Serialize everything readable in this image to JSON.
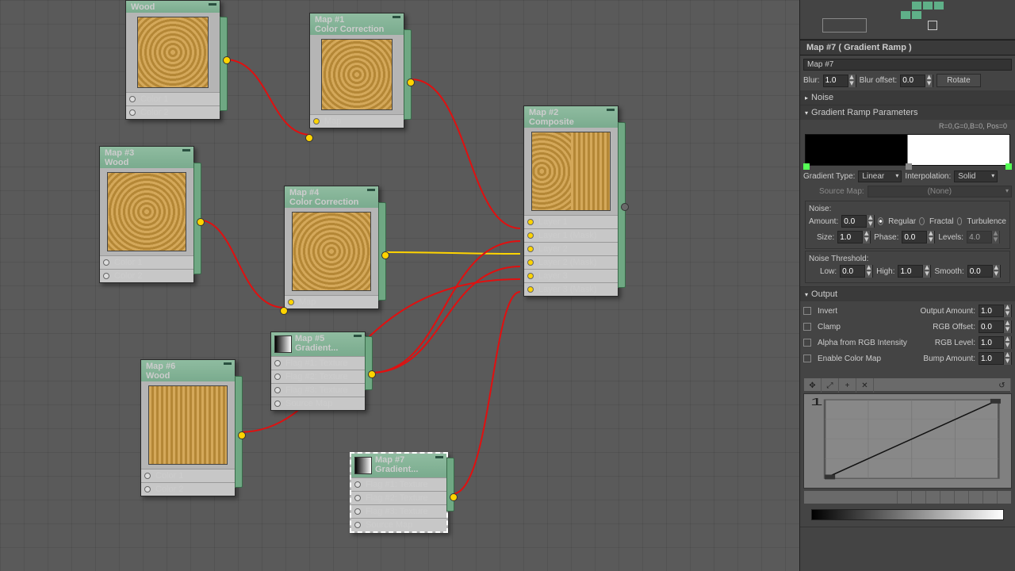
{
  "nodes": {
    "wood0": {
      "title": "Wood",
      "sub": ""
    },
    "map1": {
      "title": "Map #1",
      "sub": "Color Correction",
      "slot": "Map"
    },
    "map3": {
      "title": "Map #3",
      "sub": "Wood",
      "c1": "Color 1",
      "c2": "Color 2"
    },
    "map4": {
      "title": "Map #4",
      "sub": "Color Correction",
      "slot": "Map"
    },
    "map2": {
      "title": "Map #2",
      "sub": "Composite",
      "s1": "Layer 1",
      "s2": "Layer 1 (Mask)",
      "s3": "Layer 2",
      "s4": "Layer 2 (Mask)",
      "s5": "Layer 3",
      "s6": "Layer 3 (Mask)"
    },
    "map5": {
      "title": "Map #5",
      "sub": "Gradient...",
      "f1": "Flag #1: Texture",
      "f2": "Flag #2: Texture",
      "f3": "Flag #3: Texture",
      "sm": "Source Map"
    },
    "map6": {
      "title": "Map #6",
      "sub": "Wood",
      "c1": "Color 1",
      "c2": "Color 2"
    },
    "map7": {
      "title": "Map #7",
      "sub": "Gradient...",
      "f1": "Flag #1: Texture",
      "f2": "Flag #2: Texture",
      "f3": "Flag #3: Texture",
      "sm": "Source Map"
    }
  },
  "wood_c1": "Color 1",
  "wood_c2": "Color 2",
  "panel": {
    "title": "Map #7  ( Gradient Ramp )",
    "name": "Map #7",
    "blur_lbl": "Blur:",
    "blur": "1.0",
    "blur_off_lbl": "Blur offset:",
    "blur_off": "0.0",
    "rotate": "Rotate",
    "noise_head": "Noise",
    "grp_head": "Gradient Ramp Parameters",
    "readout": "R=0,G=0,B=0, Pos=0",
    "gtype_lbl": "Gradient Type:",
    "gtype": "Linear",
    "interp_lbl": "Interpolation:",
    "interp": "Solid",
    "srcmap_lbl": "Source Map:",
    "srcmap": "(None)",
    "noise_lbl": "Noise:",
    "amt_lbl": "Amount:",
    "amt": "0.0",
    "regular": "Regular",
    "fractal": "Fractal",
    "turb": "Turbulence",
    "size_lbl": "Size:",
    "size": "1.0",
    "phase_lbl": "Phase:",
    "phase": "0.0",
    "levels_lbl": "Levels:",
    "levels": "4.0",
    "thr_lbl": "Noise Threshold:",
    "low_lbl": "Low:",
    "low": "0.0",
    "high_lbl": "High:",
    "high": "1.0",
    "smooth_lbl": "Smooth:",
    "smooth": "0.0",
    "out_head": "Output",
    "invert": "Invert",
    "clamp": "Clamp",
    "alpha": "Alpha from RGB Intensity",
    "colormap": "Enable Color Map",
    "outamt_lbl": "Output Amount:",
    "outamt": "1.0",
    "rgboff_lbl": "RGB Offset:",
    "rgboff": "0.0",
    "rgblvl_lbl": "RGB Level:",
    "rgblvl": "1.0",
    "bump_lbl": "Bump Amount:",
    "bump": "1.0"
  }
}
